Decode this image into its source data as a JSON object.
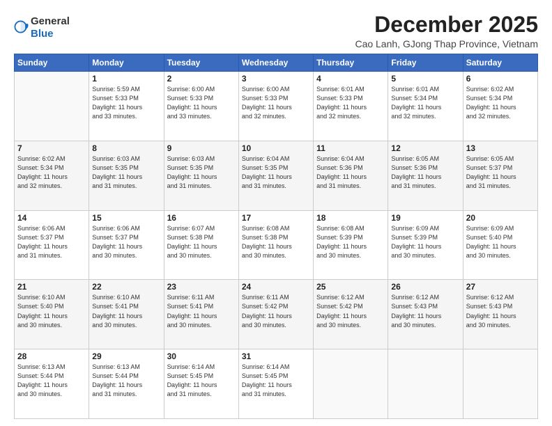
{
  "header": {
    "logo_general": "General",
    "logo_blue": "Blue",
    "main_title": "December 2025",
    "subtitle": "Cao Lanh, GJong Thap Province, Vietnam"
  },
  "days_of_week": [
    "Sunday",
    "Monday",
    "Tuesday",
    "Wednesday",
    "Thursday",
    "Friday",
    "Saturday"
  ],
  "weeks": [
    [
      {
        "day": "",
        "info": ""
      },
      {
        "day": "1",
        "info": "Sunrise: 5:59 AM\nSunset: 5:33 PM\nDaylight: 11 hours\nand 33 minutes."
      },
      {
        "day": "2",
        "info": "Sunrise: 6:00 AM\nSunset: 5:33 PM\nDaylight: 11 hours\nand 33 minutes."
      },
      {
        "day": "3",
        "info": "Sunrise: 6:00 AM\nSunset: 5:33 PM\nDaylight: 11 hours\nand 32 minutes."
      },
      {
        "day": "4",
        "info": "Sunrise: 6:01 AM\nSunset: 5:33 PM\nDaylight: 11 hours\nand 32 minutes."
      },
      {
        "day": "5",
        "info": "Sunrise: 6:01 AM\nSunset: 5:34 PM\nDaylight: 11 hours\nand 32 minutes."
      },
      {
        "day": "6",
        "info": "Sunrise: 6:02 AM\nSunset: 5:34 PM\nDaylight: 11 hours\nand 32 minutes."
      }
    ],
    [
      {
        "day": "7",
        "info": "Sunrise: 6:02 AM\nSunset: 5:34 PM\nDaylight: 11 hours\nand 32 minutes."
      },
      {
        "day": "8",
        "info": "Sunrise: 6:03 AM\nSunset: 5:35 PM\nDaylight: 11 hours\nand 31 minutes."
      },
      {
        "day": "9",
        "info": "Sunrise: 6:03 AM\nSunset: 5:35 PM\nDaylight: 11 hours\nand 31 minutes."
      },
      {
        "day": "10",
        "info": "Sunrise: 6:04 AM\nSunset: 5:35 PM\nDaylight: 11 hours\nand 31 minutes."
      },
      {
        "day": "11",
        "info": "Sunrise: 6:04 AM\nSunset: 5:36 PM\nDaylight: 11 hours\nand 31 minutes."
      },
      {
        "day": "12",
        "info": "Sunrise: 6:05 AM\nSunset: 5:36 PM\nDaylight: 11 hours\nand 31 minutes."
      },
      {
        "day": "13",
        "info": "Sunrise: 6:05 AM\nSunset: 5:37 PM\nDaylight: 11 hours\nand 31 minutes."
      }
    ],
    [
      {
        "day": "14",
        "info": "Sunrise: 6:06 AM\nSunset: 5:37 PM\nDaylight: 11 hours\nand 31 minutes."
      },
      {
        "day": "15",
        "info": "Sunrise: 6:06 AM\nSunset: 5:37 PM\nDaylight: 11 hours\nand 30 minutes."
      },
      {
        "day": "16",
        "info": "Sunrise: 6:07 AM\nSunset: 5:38 PM\nDaylight: 11 hours\nand 30 minutes."
      },
      {
        "day": "17",
        "info": "Sunrise: 6:08 AM\nSunset: 5:38 PM\nDaylight: 11 hours\nand 30 minutes."
      },
      {
        "day": "18",
        "info": "Sunrise: 6:08 AM\nSunset: 5:39 PM\nDaylight: 11 hours\nand 30 minutes."
      },
      {
        "day": "19",
        "info": "Sunrise: 6:09 AM\nSunset: 5:39 PM\nDaylight: 11 hours\nand 30 minutes."
      },
      {
        "day": "20",
        "info": "Sunrise: 6:09 AM\nSunset: 5:40 PM\nDaylight: 11 hours\nand 30 minutes."
      }
    ],
    [
      {
        "day": "21",
        "info": "Sunrise: 6:10 AM\nSunset: 5:40 PM\nDaylight: 11 hours\nand 30 minutes."
      },
      {
        "day": "22",
        "info": "Sunrise: 6:10 AM\nSunset: 5:41 PM\nDaylight: 11 hours\nand 30 minutes."
      },
      {
        "day": "23",
        "info": "Sunrise: 6:11 AM\nSunset: 5:41 PM\nDaylight: 11 hours\nand 30 minutes."
      },
      {
        "day": "24",
        "info": "Sunrise: 6:11 AM\nSunset: 5:42 PM\nDaylight: 11 hours\nand 30 minutes."
      },
      {
        "day": "25",
        "info": "Sunrise: 6:12 AM\nSunset: 5:42 PM\nDaylight: 11 hours\nand 30 minutes."
      },
      {
        "day": "26",
        "info": "Sunrise: 6:12 AM\nSunset: 5:43 PM\nDaylight: 11 hours\nand 30 minutes."
      },
      {
        "day": "27",
        "info": "Sunrise: 6:12 AM\nSunset: 5:43 PM\nDaylight: 11 hours\nand 30 minutes."
      }
    ],
    [
      {
        "day": "28",
        "info": "Sunrise: 6:13 AM\nSunset: 5:44 PM\nDaylight: 11 hours\nand 30 minutes."
      },
      {
        "day": "29",
        "info": "Sunrise: 6:13 AM\nSunset: 5:44 PM\nDaylight: 11 hours\nand 31 minutes."
      },
      {
        "day": "30",
        "info": "Sunrise: 6:14 AM\nSunset: 5:45 PM\nDaylight: 11 hours\nand 31 minutes."
      },
      {
        "day": "31",
        "info": "Sunrise: 6:14 AM\nSunset: 5:45 PM\nDaylight: 11 hours\nand 31 minutes."
      },
      {
        "day": "",
        "info": ""
      },
      {
        "day": "",
        "info": ""
      },
      {
        "day": "",
        "info": ""
      }
    ]
  ]
}
